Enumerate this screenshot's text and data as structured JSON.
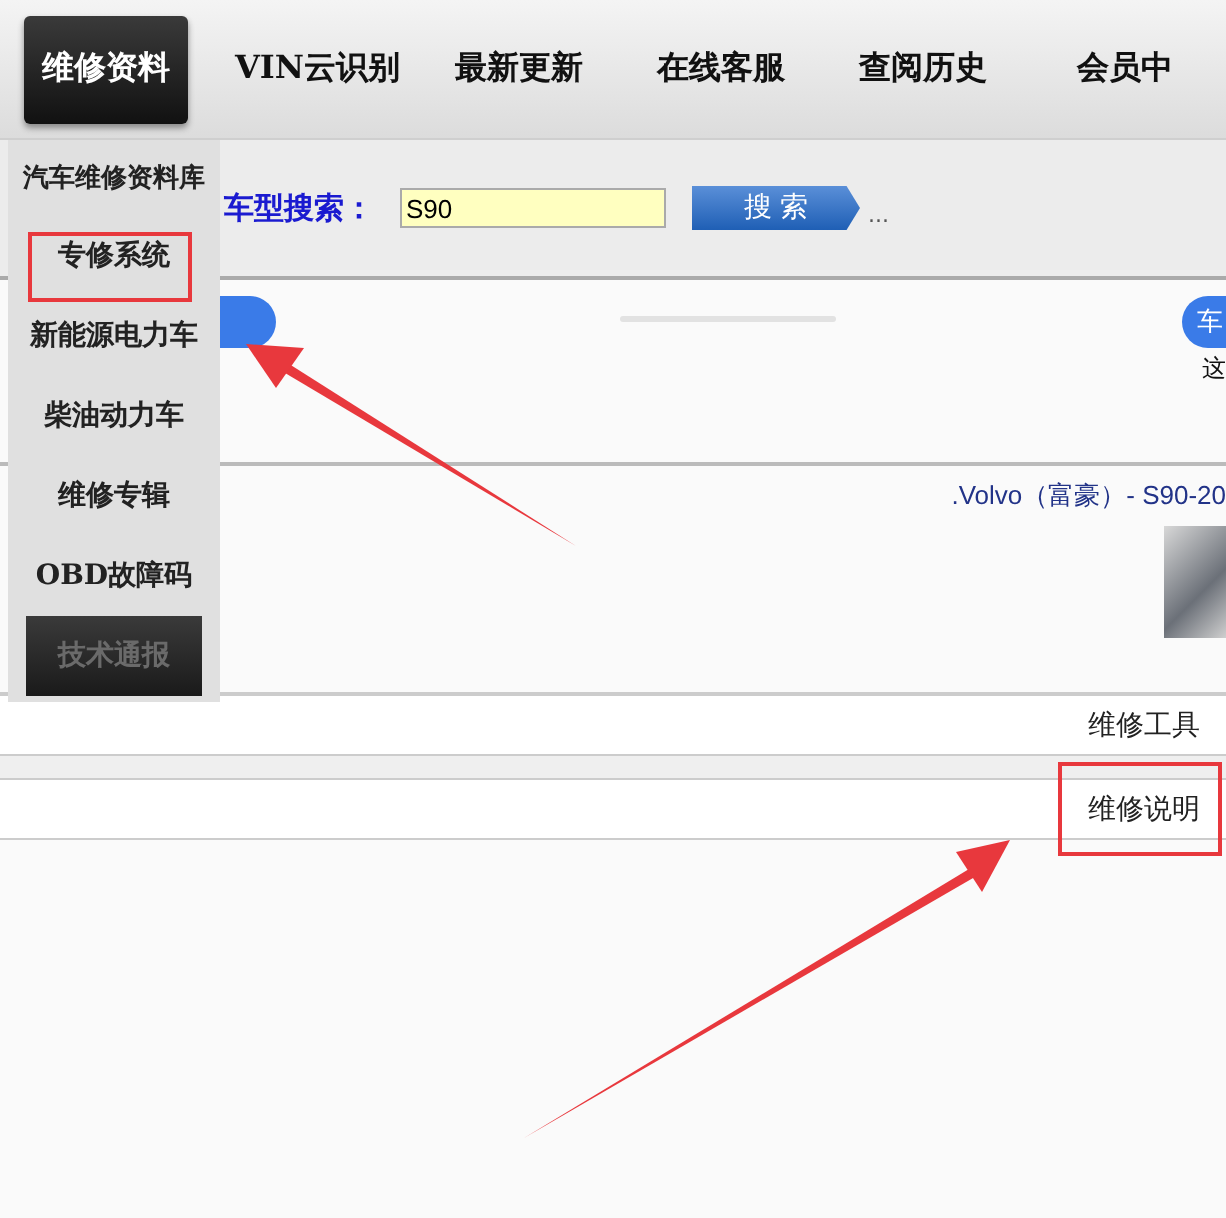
{
  "nav": {
    "tabs": [
      {
        "label": "维修资料",
        "selected": true
      },
      {
        "label": "VIN云识别",
        "selected": false
      },
      {
        "label": "最新更新",
        "selected": false
      },
      {
        "label": "在线客服",
        "selected": false
      },
      {
        "label": "查阅历史",
        "selected": false
      },
      {
        "label": "会员中",
        "selected": false
      }
    ]
  },
  "search": {
    "label": "车型搜索：",
    "value": "S90",
    "button": "搜 索",
    "more": "..."
  },
  "banner": {
    "right_pill": "车",
    "right_caption": "这"
  },
  "vehicle": {
    "title": ".Volvo（富豪）- S90-20"
  },
  "rows": [
    {
      "label": "维修工具"
    },
    {
      "label": "维修说明"
    }
  ],
  "dropdown": {
    "items": [
      {
        "label": "汽车维修资料库",
        "kind": "plain"
      },
      {
        "label": "专修系统",
        "kind": "plain"
      },
      {
        "label": "新能源电力车",
        "kind": "plain"
      },
      {
        "label": "柴油动力车",
        "kind": "plain"
      },
      {
        "label": "维修专辑",
        "kind": "plain"
      },
      {
        "label": "OBD故障码",
        "kind": "plain"
      },
      {
        "label": "技术通报",
        "kind": "dark"
      }
    ]
  }
}
